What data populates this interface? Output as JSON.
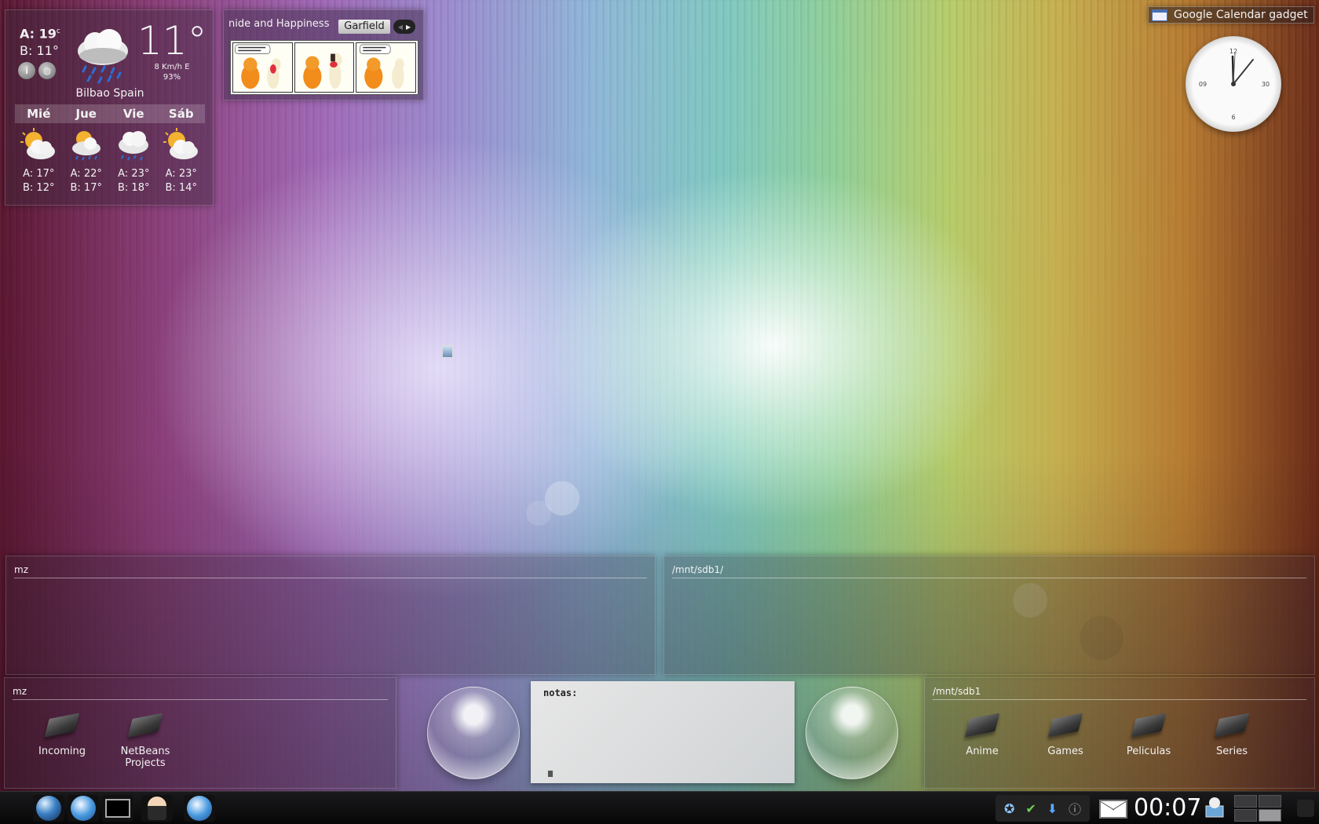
{
  "weather": {
    "high": "A: 19",
    "high_unit": "c",
    "low": "B: 11°",
    "current_temp": "11°",
    "wind": "8 Km/h E",
    "humidity": "93%",
    "location": "Bilbao Spain",
    "days": [
      "Mié",
      "Jue",
      "Vie",
      "Sáb"
    ],
    "highs": [
      "A: 17°",
      "A: 22°",
      "A: 23°",
      "A: 23°"
    ],
    "lows": [
      "B: 12°",
      "B: 17°",
      "B: 18°",
      "B: 14°"
    ]
  },
  "comic": {
    "title": "nide and Happiness",
    "selected": "Garfield"
  },
  "calendar_gadget": {
    "label": "Google Calendar gadget"
  },
  "folders": {
    "mz_top": {
      "title": "mz"
    },
    "sdb_top": {
      "title": "/mnt/sdb1/"
    },
    "mz_bottom": {
      "title": "mz",
      "items": [
        "Incoming",
        "NetBeans Projects"
      ]
    },
    "sdb_bottom": {
      "title": "/mnt/sdb1",
      "items": [
        "Anime",
        "Games",
        "Peliculas",
        "Series"
      ]
    }
  },
  "note": {
    "label": "notas:"
  },
  "taskbar": {
    "clock": "00:07"
  },
  "colors": {
    "taskbar_bg": "#0b0b0c",
    "panel_bg": "rgba(50,40,55,0.28)"
  }
}
